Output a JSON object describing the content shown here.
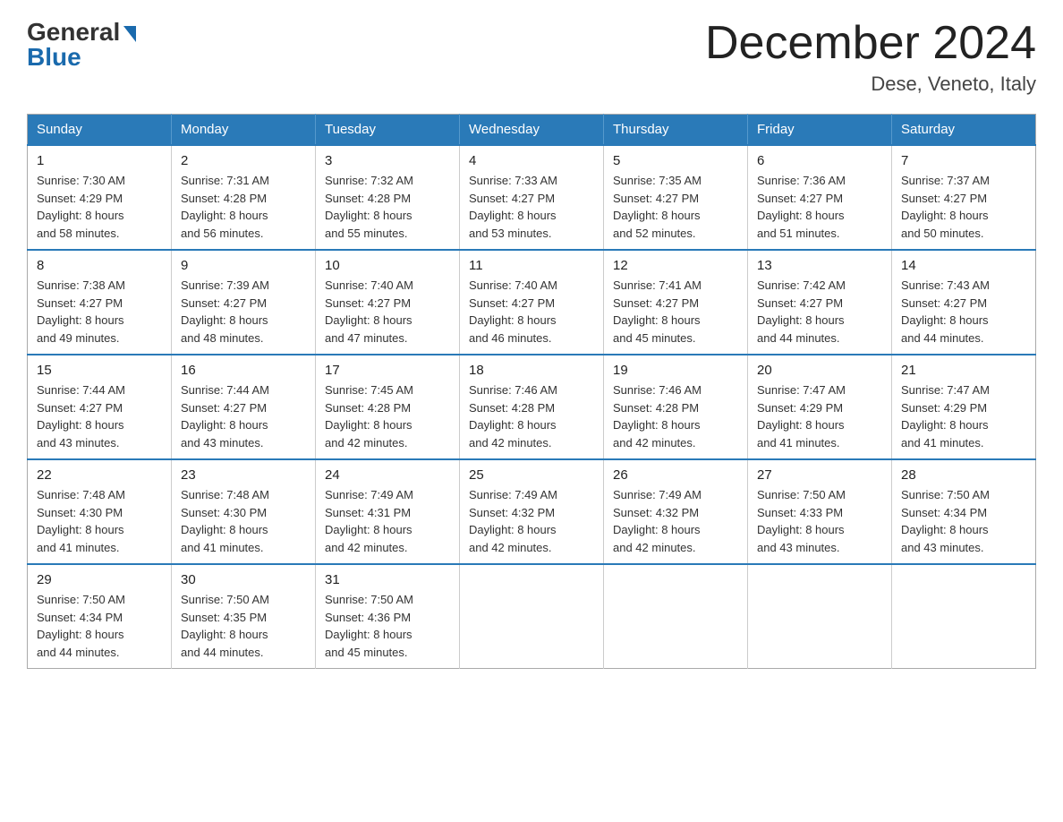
{
  "header": {
    "logo_text_general": "General",
    "logo_text_blue": "Blue",
    "month_year": "December 2024",
    "location": "Dese, Veneto, Italy"
  },
  "days_of_week": [
    "Sunday",
    "Monday",
    "Tuesday",
    "Wednesday",
    "Thursday",
    "Friday",
    "Saturday"
  ],
  "weeks": [
    [
      {
        "day": "1",
        "sunrise": "7:30 AM",
        "sunset": "4:29 PM",
        "daylight": "8 hours and 58 minutes."
      },
      {
        "day": "2",
        "sunrise": "7:31 AM",
        "sunset": "4:28 PM",
        "daylight": "8 hours and 56 minutes."
      },
      {
        "day": "3",
        "sunrise": "7:32 AM",
        "sunset": "4:28 PM",
        "daylight": "8 hours and 55 minutes."
      },
      {
        "day": "4",
        "sunrise": "7:33 AM",
        "sunset": "4:27 PM",
        "daylight": "8 hours and 53 minutes."
      },
      {
        "day": "5",
        "sunrise": "7:35 AM",
        "sunset": "4:27 PM",
        "daylight": "8 hours and 52 minutes."
      },
      {
        "day": "6",
        "sunrise": "7:36 AM",
        "sunset": "4:27 PM",
        "daylight": "8 hours and 51 minutes."
      },
      {
        "day": "7",
        "sunrise": "7:37 AM",
        "sunset": "4:27 PM",
        "daylight": "8 hours and 50 minutes."
      }
    ],
    [
      {
        "day": "8",
        "sunrise": "7:38 AM",
        "sunset": "4:27 PM",
        "daylight": "8 hours and 49 minutes."
      },
      {
        "day": "9",
        "sunrise": "7:39 AM",
        "sunset": "4:27 PM",
        "daylight": "8 hours and 48 minutes."
      },
      {
        "day": "10",
        "sunrise": "7:40 AM",
        "sunset": "4:27 PM",
        "daylight": "8 hours and 47 minutes."
      },
      {
        "day": "11",
        "sunrise": "7:40 AM",
        "sunset": "4:27 PM",
        "daylight": "8 hours and 46 minutes."
      },
      {
        "day": "12",
        "sunrise": "7:41 AM",
        "sunset": "4:27 PM",
        "daylight": "8 hours and 45 minutes."
      },
      {
        "day": "13",
        "sunrise": "7:42 AM",
        "sunset": "4:27 PM",
        "daylight": "8 hours and 44 minutes."
      },
      {
        "day": "14",
        "sunrise": "7:43 AM",
        "sunset": "4:27 PM",
        "daylight": "8 hours and 44 minutes."
      }
    ],
    [
      {
        "day": "15",
        "sunrise": "7:44 AM",
        "sunset": "4:27 PM",
        "daylight": "8 hours and 43 minutes."
      },
      {
        "day": "16",
        "sunrise": "7:44 AM",
        "sunset": "4:27 PM",
        "daylight": "8 hours and 43 minutes."
      },
      {
        "day": "17",
        "sunrise": "7:45 AM",
        "sunset": "4:28 PM",
        "daylight": "8 hours and 42 minutes."
      },
      {
        "day": "18",
        "sunrise": "7:46 AM",
        "sunset": "4:28 PM",
        "daylight": "8 hours and 42 minutes."
      },
      {
        "day": "19",
        "sunrise": "7:46 AM",
        "sunset": "4:28 PM",
        "daylight": "8 hours and 42 minutes."
      },
      {
        "day": "20",
        "sunrise": "7:47 AM",
        "sunset": "4:29 PM",
        "daylight": "8 hours and 41 minutes."
      },
      {
        "day": "21",
        "sunrise": "7:47 AM",
        "sunset": "4:29 PM",
        "daylight": "8 hours and 41 minutes."
      }
    ],
    [
      {
        "day": "22",
        "sunrise": "7:48 AM",
        "sunset": "4:30 PM",
        "daylight": "8 hours and 41 minutes."
      },
      {
        "day": "23",
        "sunrise": "7:48 AM",
        "sunset": "4:30 PM",
        "daylight": "8 hours and 41 minutes."
      },
      {
        "day": "24",
        "sunrise": "7:49 AM",
        "sunset": "4:31 PM",
        "daylight": "8 hours and 42 minutes."
      },
      {
        "day": "25",
        "sunrise": "7:49 AM",
        "sunset": "4:32 PM",
        "daylight": "8 hours and 42 minutes."
      },
      {
        "day": "26",
        "sunrise": "7:49 AM",
        "sunset": "4:32 PM",
        "daylight": "8 hours and 42 minutes."
      },
      {
        "day": "27",
        "sunrise": "7:50 AM",
        "sunset": "4:33 PM",
        "daylight": "8 hours and 43 minutes."
      },
      {
        "day": "28",
        "sunrise": "7:50 AM",
        "sunset": "4:34 PM",
        "daylight": "8 hours and 43 minutes."
      }
    ],
    [
      {
        "day": "29",
        "sunrise": "7:50 AM",
        "sunset": "4:34 PM",
        "daylight": "8 hours and 44 minutes."
      },
      {
        "day": "30",
        "sunrise": "7:50 AM",
        "sunset": "4:35 PM",
        "daylight": "8 hours and 44 minutes."
      },
      {
        "day": "31",
        "sunrise": "7:50 AM",
        "sunset": "4:36 PM",
        "daylight": "8 hours and 45 minutes."
      },
      null,
      null,
      null,
      null
    ]
  ],
  "labels": {
    "sunrise": "Sunrise:",
    "sunset": "Sunset:",
    "daylight": "Daylight:"
  }
}
